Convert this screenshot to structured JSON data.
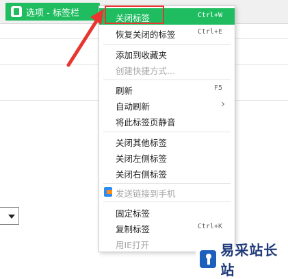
{
  "tab": {
    "title": "选项 - 标签栏"
  },
  "colors": {
    "accent": "#1fbd60",
    "highlight_box": "#e8352f"
  },
  "menu": {
    "items": [
      {
        "label": "关闭标签",
        "shortcut": "Ctrl+W",
        "highlighted": true
      },
      {
        "label": "恢复关闭的标签",
        "shortcut": "Ctrl+E"
      },
      {
        "label": "添加到收藏夹"
      },
      {
        "label": "创建快捷方式...",
        "disabled": true
      },
      {
        "label": "刷新",
        "shortcut": "F5"
      },
      {
        "label": "自动刷新",
        "submenu_icon": "chevron-right-icon"
      },
      {
        "label": "将此标签页静音"
      },
      {
        "label": "关闭其他标签"
      },
      {
        "label": "关闭左侧标签"
      },
      {
        "label": "关闭右侧标签"
      },
      {
        "label": "发送链接到手机",
        "disabled": true,
        "icon": "phone-send-icon"
      },
      {
        "label": "固定标签"
      },
      {
        "label": "复制标签",
        "shortcut": "Ctrl+K"
      },
      {
        "label": "用IE打开",
        "disabled": true
      }
    ]
  },
  "watermark": {
    "text": "易采站长站",
    "logo_icon": "site-logo-icon"
  }
}
